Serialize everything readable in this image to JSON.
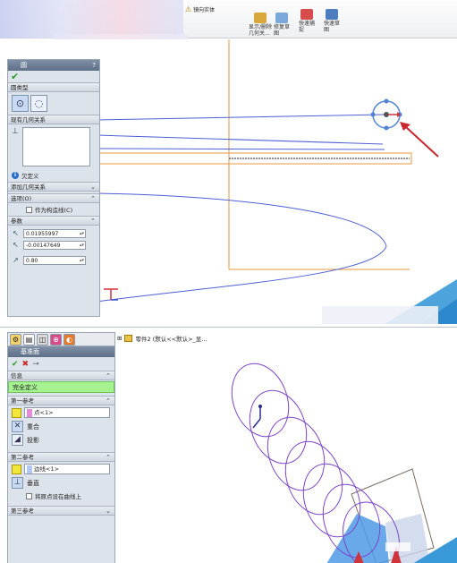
{
  "top": {
    "ribbon": {
      "mirror_label": "镜向实体",
      "commands": [
        {
          "label": "显示/删除\n几何关...",
          "color": "#d9a73c"
        },
        {
          "label": "修复草\n图",
          "color": "#7aa8d8"
        },
        {
          "label": "快速捕\n捉",
          "color": "#d74c4c"
        },
        {
          "label": "快速草\n图",
          "color": "#4f7ec0"
        }
      ]
    },
    "panel": {
      "title": "圆",
      "help": "?",
      "sections": {
        "circle_type": "圆类型",
        "existing_relations": "现有几何关系",
        "add_relations": "添加几何关系",
        "options": "选项(O)",
        "parameters": "参数"
      },
      "status": "欠定义",
      "construction_checkbox": "作为构造线(C)",
      "params": [
        "0.01955997",
        "-0.00147649",
        "0.80"
      ]
    }
  },
  "bottom": {
    "tree": "零件2  (默认<<默认>_显...",
    "panel": {
      "title": "基准面",
      "message_header": "信息",
      "status": "完全定义",
      "first_ref": {
        "header": "第一参考",
        "value": "点<1>",
        "options": [
          "重合",
          "投影"
        ]
      },
      "second_ref": {
        "header": "第二参考",
        "value": "边线<1>",
        "options": [
          "垂直"
        ],
        "checkbox": "将原点设在曲线上"
      },
      "third_ref": {
        "header": "第三参考"
      }
    }
  },
  "colors": {
    "status_green": "#a6f291",
    "curve_blue": "#4e5fd6",
    "sketch_orange": "#e49a3c",
    "pointer_red": "#d1333a"
  }
}
